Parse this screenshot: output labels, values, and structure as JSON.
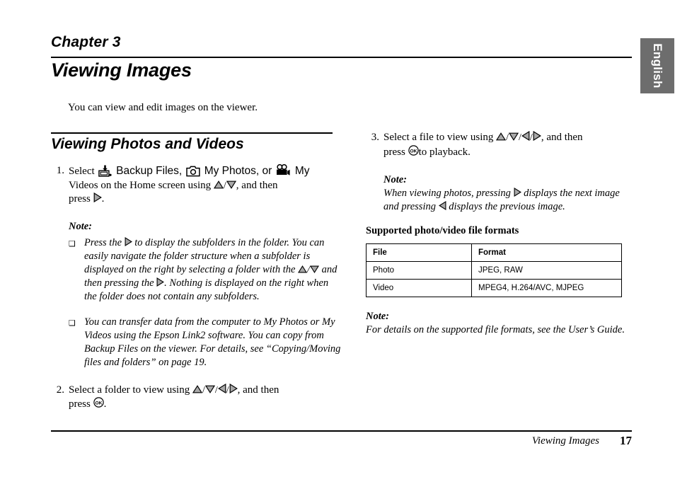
{
  "language_tab": {
    "label": "English"
  },
  "header": {
    "chapter": "Chapter 3",
    "title": "Viewing Images",
    "intro": "You can view and edit images on the viewer."
  },
  "section": {
    "title": "Viewing Photos and Videos"
  },
  "steps": {
    "step1": {
      "number": "1.",
      "lead": "Select",
      "item1_label": "Backup Files,",
      "item2_label": "My Photos, or",
      "item3_label": "My",
      "tail_line2": "Videos on the Home screen using",
      "tail_line2_end": ", and then",
      "tail_line3": "press",
      "tail_line3_end": "."
    },
    "step1_note": {
      "heading": "Note:",
      "bullet1_a": "Press the",
      "bullet1_b": "to display the subfolders in the folder. You can easily navigate the folder structure when a subfolder is displayed on the right by selecting a folder with the",
      "bullet1_c": "and then pressing the",
      "bullet1_d": ". Nothing is displayed on the right when the folder does not contain any subfolders.",
      "bullet2": "You can transfer data from the computer to My Photos or My Videos using the Epson Link2 software. You can copy from Backup Files on the viewer. For details, see “Copying/Moving files and folders” on page 19.",
      "bullet_glyph": "❑"
    },
    "step2": {
      "number": "2.",
      "lead": "Select a folder to view using",
      "tail": ", and then",
      "line2": "press",
      "line2_end": "."
    },
    "step3": {
      "number": "3.",
      "lead": "Select a file to view using",
      "tail": ", and then",
      "line2": "press",
      "line2_end": "to playback."
    },
    "step3_note": {
      "heading": "Note:",
      "part_a": "When viewing photos, pressing",
      "part_b": "displays the next image and pressing",
      "part_c": "displays the previous image."
    }
  },
  "formats": {
    "subheading": "Supported photo/video file formats",
    "columns": [
      "File",
      "Format"
    ],
    "rows": [
      {
        "file": "Photo",
        "format": "JPEG, RAW"
      },
      {
        "file": "Video",
        "format": "MPEG4, H.264/AVC, MJPEG"
      }
    ]
  },
  "table_note": {
    "heading": "Note:",
    "body": "For details on the supported file formats, see the User’s Guide."
  },
  "footer": {
    "title": "Viewing Images",
    "page": "17"
  },
  "icons": {
    "backup_files": "backup-files-icon",
    "my_photos": "camera-icon",
    "my_videos": "video-camera-icon",
    "up": "up-arrow-key-icon",
    "down": "down-arrow-key-icon",
    "left": "left-arrow-key-icon",
    "right": "right-arrow-key-icon",
    "ok": "ok-button-icon"
  },
  "colors": {
    "tab_background": "#6d6d6d",
    "tab_text": "#ffffff",
    "text": "#000000",
    "key_fill": "#a8a8a8",
    "page_background": "#ffffff"
  },
  "separators": {
    "slash": "/"
  }
}
